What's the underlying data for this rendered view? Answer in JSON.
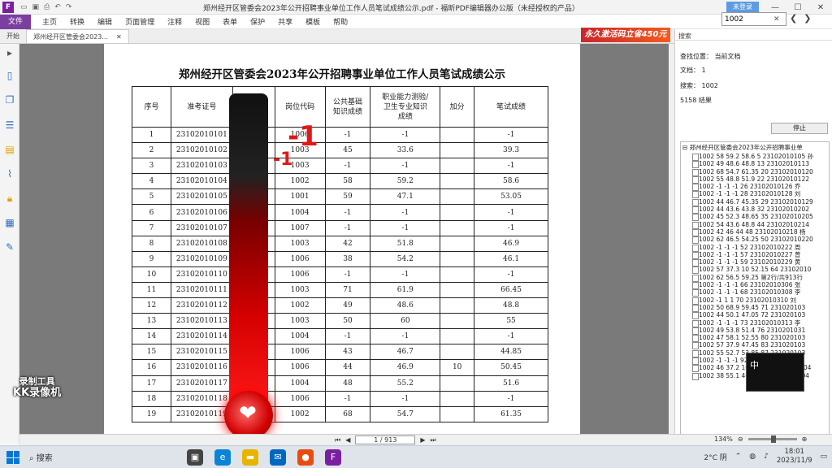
{
  "window": {
    "title": "郑州经开区管委会2023年公开招聘事业单位工作人员笔试成绩公示.pdf - 福昕PDF编辑器办公版（未经授权的产品）",
    "login_label": "未登录",
    "minimize": "—",
    "maximize": "☐",
    "close": "✕"
  },
  "menu": {
    "file": "文件",
    "items": [
      "主页",
      "转换",
      "编辑",
      "页面管理",
      "注释",
      "视图",
      "表单",
      "保护",
      "共享",
      "模板",
      "帮助"
    ]
  },
  "top_search": {
    "value": "1002",
    "clear": "✕",
    "prev": "❮",
    "next": "❯"
  },
  "tabs": [
    {
      "label": "开始",
      "close": ""
    },
    {
      "label": "郑州经开区管委会2023...",
      "close": "✕"
    }
  ],
  "ad": {
    "text": "永久激活码立省450元"
  },
  "document": {
    "title": "郑州经开区管委会2023年公开招聘事业单位工作人员笔试成绩公示",
    "headers": [
      "序号",
      "准考证号",
      "",
      "岗位代码",
      "公共基础\n知识成绩",
      "职业能力测验/\n卫生专业知识\n成绩",
      "加分",
      "笔试成绩"
    ],
    "rows": [
      [
        "1",
        "23102010101",
        "",
        "1006",
        "-1",
        "-1",
        "",
        "-1"
      ],
      [
        "2",
        "23102010102",
        "",
        "1003",
        "45",
        "33.6",
        "",
        "39.3"
      ],
      [
        "3",
        "23102010103",
        "",
        "1003",
        "-1",
        "-1",
        "",
        "-1"
      ],
      [
        "4",
        "23102010104",
        "",
        "1002",
        "58",
        "59.2",
        "",
        "58.6"
      ],
      [
        "5",
        "23102010105",
        "",
        "1001",
        "59",
        "47.1",
        "",
        "53.05"
      ],
      [
        "6",
        "23102010106",
        "",
        "1004",
        "-1",
        "-1",
        "",
        "-1"
      ],
      [
        "7",
        "23102010107",
        "",
        "1007",
        "-1",
        "-1",
        "",
        "-1"
      ],
      [
        "8",
        "23102010108",
        "",
        "1003",
        "42",
        "51.8",
        "",
        "46.9"
      ],
      [
        "9",
        "23102010109",
        "",
        "1006",
        "38",
        "54.2",
        "",
        "46.1"
      ],
      [
        "10",
        "23102010110",
        "",
        "1006",
        "-1",
        "-1",
        "",
        "-1"
      ],
      [
        "11",
        "23102010111",
        "",
        "1003",
        "71",
        "61.9",
        "",
        "66.45"
      ],
      [
        "12",
        "23102010112",
        "",
        "1002",
        "49",
        "48.6",
        "",
        "48.8"
      ],
      [
        "13",
        "23102010113",
        "",
        "1003",
        "50",
        "60",
        "",
        "55"
      ],
      [
        "14",
        "23102010114",
        "",
        "1004",
        "-1",
        "-1",
        "",
        "-1"
      ],
      [
        "15",
        "23102010115",
        "",
        "1006",
        "43",
        "46.7",
        "",
        "44.85"
      ],
      [
        "16",
        "23102010116",
        "",
        "1006",
        "44",
        "46.9",
        "10",
        "50.45"
      ],
      [
        "17",
        "23102010117",
        "",
        "1004",
        "48",
        "55.2",
        "",
        "51.6"
      ],
      [
        "18",
        "23102010118",
        "",
        "1006",
        "-1",
        "-1",
        "",
        "-1"
      ],
      [
        "19",
        "23102010119",
        "",
        "1002",
        "68",
        "54.7",
        "",
        "61.35"
      ]
    ]
  },
  "overlay": {
    "minus_a": "-1",
    "minus_b": "-1",
    "heart": "❤"
  },
  "search_panel": {
    "header": "搜索",
    "scope": "查找位置：  当前文档",
    "docs": "文档：  1",
    "keyword": "搜索：  1002",
    "results": "5158 结果",
    "stop_label": "停止",
    "root": "郑州经开区管委会2023年公开招聘事业单",
    "items": [
      "1002 58 59.2 58.6 5 23102010105 孙",
      "1002 49 48.6 48.8 13 23102010113",
      "1002 68 54.7 61.35 20 23102010120",
      "1002 55 48.8 51.9 22 23102010122",
      "1002 -1 -1 -1 26 23102010126 乔",
      "1002 -1 -1 -1 28 23102010128 刘",
      "1002 44 46.7 45.35 29 23102010129",
      "1002 44 43.6 43.8 32 23102010202",
      "1002 45 52.3 48.65 35 23102010205",
      "1002 54 43.6 48.8 44 23102010214",
      "1002 42 46 44 48 23102010218 杨",
      "1002 62 46.5 54.25 50 23102010220",
      "1002 -1 -1 -1 52 23102010222 周",
      "1002 -1 -1 -1 57 23102010227 曾",
      "1002 -1 -1 -1 59 23102010229 黄",
      "1002 57 37.3 10 52.15 64 23102010",
      "1002 62 56.5 59.25 第2行/共913行",
      "1002 -1 -1 -1 66 23102010306 张",
      "1002 -1 -1 -1 68 23102010308 李",
      "1002 -1 1 1 70 23102010310 刘",
      "1002 50 68.9 59.45 71 231020103",
      "1002 44 50.1 47.05 72 231020103",
      "1002 -1 -1 -1 73 23102010313 李",
      "1002 49 53.8 51.4 76 2310201031",
      "1002 47 58.1 52.55 80 231020103",
      "1002 57 37.9 47.45 83 231020103",
      "1002 55 52.7 53.85 87 231020103",
      "1002 -1 -1 -1 92 23102010332",
      "1002 46 37.2 10 46.6 99 231020104",
      "1002 38 55.1 46.55 102 231020104"
    ]
  },
  "watermark": {
    "line1": "录制工具",
    "line2": "KK录像机"
  },
  "camera": {
    "label": "中"
  },
  "navigation": {
    "first": "⏮",
    "prev": "◀",
    "page": "1 / 913",
    "next": "▶",
    "last": "⏭",
    "zoom": "134%",
    "zoom_out": "⊖",
    "zoom_in": "⊕"
  },
  "taskbar": {
    "search_label": "搜索",
    "weather": "2°C 阴",
    "time": "18:01",
    "date": "2023/11/9"
  }
}
